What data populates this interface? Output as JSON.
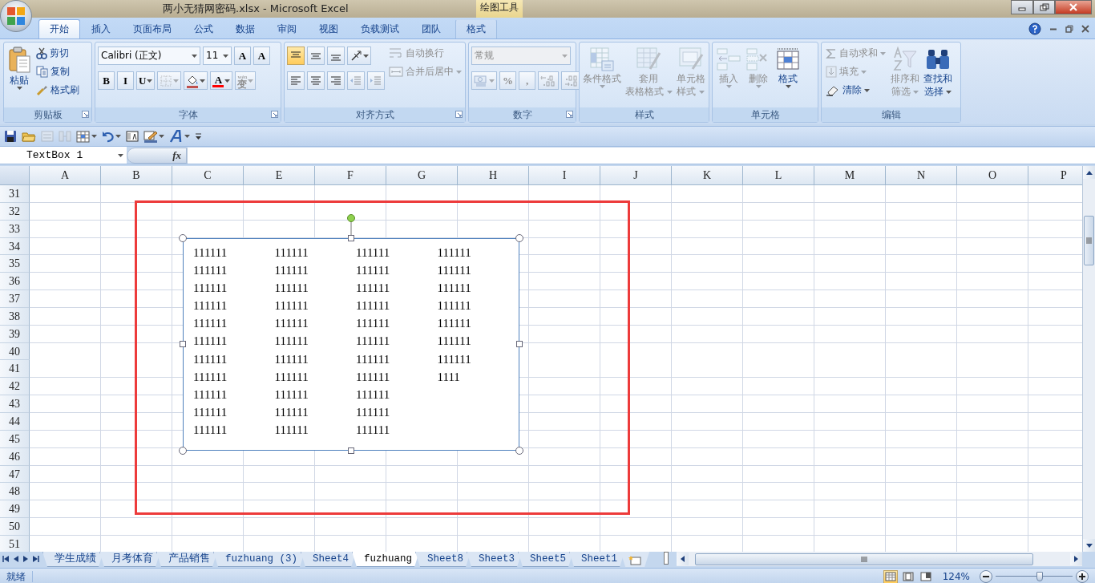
{
  "window": {
    "title": "两小无猜网密码.xlsx - Microsoft Excel",
    "context_label": "绘图工具"
  },
  "tabs": [
    {
      "label": "开始",
      "selected": true,
      "contextual": false
    },
    {
      "label": "插入",
      "selected": false,
      "contextual": false
    },
    {
      "label": "页面布局",
      "selected": false,
      "contextual": false
    },
    {
      "label": "公式",
      "selected": false,
      "contextual": false
    },
    {
      "label": "数据",
      "selected": false,
      "contextual": false
    },
    {
      "label": "审阅",
      "selected": false,
      "contextual": false
    },
    {
      "label": "视图",
      "selected": false,
      "contextual": false
    },
    {
      "label": "负载测试",
      "selected": false,
      "contextual": false
    },
    {
      "label": "团队",
      "selected": false,
      "contextual": false
    },
    {
      "label": "格式",
      "selected": false,
      "contextual": true
    }
  ],
  "ribbon": {
    "groups": [
      {
        "label": "剪贴板",
        "launcher": true,
        "blocks": [
          {
            "kind": "large",
            "lines": [
              "粘贴"
            ],
            "caret": true,
            "disabled": false
          },
          {
            "kind": "stack",
            "items": [
              {
                "kind": "small",
                "label": "剪切",
                "caret": false,
                "disabled": false
              },
              {
                "kind": "small",
                "label": "复制",
                "caret": false,
                "disabled": false
              },
              {
                "kind": "small",
                "label": "格式刷",
                "caret": false,
                "disabled": false
              }
            ]
          }
        ]
      },
      {
        "label": "字体",
        "launcher": true,
        "blocks": [
          {
            "kind": "bars",
            "bars": [
              {
                "controls": [
                  {
                    "kind": "combo",
                    "value": "Calibri (正文)",
                    "disabled": false
                  },
                  {
                    "kind": "combo",
                    "value": "11",
                    "disabled": false
                  },
                  {
                    "kind": "text",
                    "label": "A",
                    "caret": false,
                    "disabled": false
                  },
                  {
                    "kind": "text",
                    "label": "A",
                    "caret": false,
                    "disabled": false
                  }
                ]
              },
              {
                "controls": [
                  {
                    "kind": "text",
                    "label": "B",
                    "caret": false,
                    "disabled": false
                  },
                  {
                    "kind": "text",
                    "label": "I",
                    "caret": false,
                    "disabled": false
                  },
                  {
                    "kind": "text",
                    "label": "U",
                    "caret": true,
                    "disabled": false
                  },
                  {
                    "kind": "icon",
                    "caret": true,
                    "disabled": true
                  },
                  {
                    "kind": "icon",
                    "caret": true,
                    "disabled": false,
                    "color": "#c0504d"
                  },
                  {
                    "kind": "text",
                    "label": "A",
                    "caret": true,
                    "disabled": false,
                    "color": "#ff0000"
                  },
                  {
                    "kind": "ruby",
                    "ruby": "wén",
                    "label": "变",
                    "caret": true,
                    "disabled": true
                  }
                ]
              }
            ]
          }
        ]
      },
      {
        "label": "对齐方式",
        "launcher": true,
        "blocks": [
          {
            "kind": "bars",
            "bars": [
              {
                "controls": [
                  {
                    "kind": "icon",
                    "caret": false,
                    "disabled": false,
                    "selected": true
                  },
                  {
                    "kind": "icon",
                    "caret": false,
                    "disabled": false,
                    "selected": false
                  },
                  {
                    "kind": "icon",
                    "caret": false,
                    "disabled": false,
                    "selected": false
                  },
                  {
                    "kind": "icon",
                    "caret": true,
                    "disabled": false
                  }
                ]
              },
              {
                "controls": [
                  {
                    "kind": "icon",
                    "caret": false,
                    "disabled": false,
                    "selected": false
                  },
                  {
                    "kind": "icon",
                    "caret": false,
                    "disabled": false,
                    "selected": false
                  },
                  {
                    "kind": "icon",
                    "caret": false,
                    "disabled": false,
                    "selected": false
                  },
                  {
                    "kind": "icon",
                    "caret": false,
                    "disabled": true
                  },
                  {
                    "kind": "icon",
                    "caret": false,
                    "disabled": true
                  }
                ]
              }
            ]
          },
          {
            "kind": "stack",
            "items": [
              {
                "kind": "small",
                "label": "自动换行",
                "caret": false,
                "disabled": true
              },
              {
                "kind": "small",
                "label": "合并后居中",
                "caret": true,
                "disabled": true
              }
            ]
          }
        ]
      },
      {
        "label": "数字",
        "launcher": true,
        "blocks": [
          {
            "kind": "bars",
            "bars": [
              {
                "controls": [
                  {
                    "kind": "combo",
                    "value": "常规",
                    "disabled": true
                  }
                ]
              },
              {
                "controls": [
                  {
                    "kind": "icon",
                    "caret": true,
                    "disabled": true
                  },
                  {
                    "kind": "text",
                    "label": "%",
                    "caret": false,
                    "disabled": true
                  },
                  {
                    "kind": "text",
                    "label": ",",
                    "caret": false,
                    "disabled": true
                  },
                  {
                    "kind": "icon",
                    "caret": false,
                    "disabled": true
                  },
                  {
                    "kind": "icon",
                    "caret": false,
                    "disabled": true
                  }
                ]
              }
            ]
          }
        ]
      },
      {
        "label": "样式",
        "launcher": false,
        "blocks": [
          {
            "kind": "large",
            "lines": [
              "条件格式"
            ],
            "caret": true,
            "disabled": true
          },
          {
            "kind": "large",
            "lines": [
              "套用",
              "表格格式"
            ],
            "caret": true,
            "disabled": true
          },
          {
            "kind": "large",
            "lines": [
              "单元格",
              "样式"
            ],
            "caret": true,
            "disabled": true
          }
        ]
      },
      {
        "label": "单元格",
        "launcher": false,
        "blocks": [
          {
            "kind": "large",
            "lines": [
              "插入"
            ],
            "caret": true,
            "disabled": true
          },
          {
            "kind": "large",
            "lines": [
              "删除"
            ],
            "caret": true,
            "disabled": true
          },
          {
            "kind": "large",
            "lines": [
              "格式"
            ],
            "caret": true,
            "disabled": false
          }
        ]
      },
      {
        "label": "编辑",
        "launcher": false,
        "blocks": [
          {
            "kind": "stack",
            "items": [
              {
                "kind": "small",
                "label": "自动求和",
                "caret": true,
                "disabled": true
              },
              {
                "kind": "small",
                "label": "填充",
                "caret": true,
                "disabled": true
              },
              {
                "kind": "small",
                "label": "清除",
                "caret": true,
                "disabled": false
              }
            ]
          },
          {
            "kind": "large",
            "lines": [
              "排序和",
              "筛选"
            ],
            "caret": true,
            "disabled": true
          },
          {
            "kind": "large",
            "lines": [
              "查找和",
              "选择"
            ],
            "caret": true,
            "disabled": false
          }
        ]
      }
    ]
  },
  "quick_access": [
    {
      "caret": false,
      "disabled": false
    },
    {
      "caret": false,
      "disabled": false
    },
    {
      "caret": false,
      "disabled": true
    },
    {
      "caret": false,
      "disabled": true
    },
    {
      "caret": true,
      "disabled": false
    },
    {
      "caret": true,
      "disabled": false
    },
    {
      "caret": false,
      "disabled": false
    },
    {
      "caret": true,
      "disabled": false
    },
    {
      "caret": true,
      "disabled": false
    },
    {
      "caret": false,
      "disabled": false
    }
  ],
  "formula_bar": {
    "name_box": "TextBox 1",
    "function_button": "fx"
  },
  "sheet": {
    "columns": [
      "A",
      "B",
      "C",
      "E",
      "F",
      "G",
      "H",
      "I",
      "J",
      "K",
      "L",
      "M",
      "N",
      "O",
      "P"
    ],
    "rows": [
      "31",
      "32",
      "33",
      "34",
      "35",
      "36",
      "37",
      "38",
      "39",
      "40",
      "41",
      "42",
      "43",
      "44",
      "45",
      "46",
      "47",
      "48",
      "49",
      "50",
      "51"
    ]
  },
  "text_box": {
    "columns": [
      [
        "111111",
        "111111",
        "111111",
        "111111",
        "111111",
        "111111",
        "111111",
        "111111",
        "111111",
        "111111",
        "111111"
      ],
      [
        "111111",
        "111111",
        "111111",
        "111111",
        "111111",
        "111111",
        "111111",
        "111111",
        "111111",
        "111111",
        "111111"
      ],
      [
        "111111",
        "111111",
        "111111",
        "111111",
        "111111",
        "111111",
        "111111",
        "111111",
        "111111",
        "111111",
        "111111"
      ],
      [
        "111111",
        "111111",
        "111111",
        "111111",
        "111111",
        "111111",
        "111111",
        "1111"
      ]
    ]
  },
  "sheet_tabs": [
    {
      "label": "学生成绩",
      "selected": false
    },
    {
      "label": "月考体育",
      "selected": false
    },
    {
      "label": "产品销售",
      "selected": false
    },
    {
      "label": "fuzhuang (3)",
      "selected": false
    },
    {
      "label": "Sheet4",
      "selected": false
    },
    {
      "label": "fuzhuang",
      "selected": true
    },
    {
      "label": "Sheet8",
      "selected": false
    },
    {
      "label": "Sheet3",
      "selected": false
    },
    {
      "label": "Sheet5",
      "selected": false
    },
    {
      "label": "Sheet1",
      "selected": false
    }
  ],
  "status_bar": {
    "status": "就绪",
    "views": [
      {
        "selected": true
      },
      {
        "selected": false
      },
      {
        "selected": false
      }
    ],
    "zoom": {
      "text": "124%",
      "level": 0.57
    }
  }
}
